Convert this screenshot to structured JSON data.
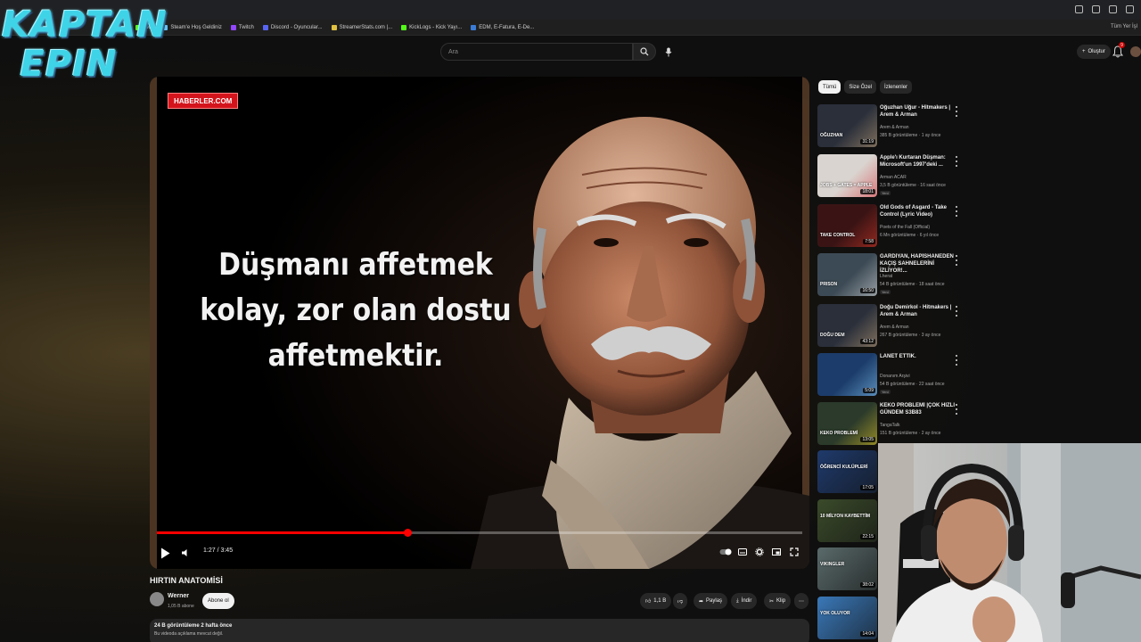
{
  "browser": {
    "bookmarks": [
      {
        "label": "Kick",
        "color": "#53fc18"
      },
      {
        "label": "Steam'e Hoş Geldiniz",
        "color": "#66c0f4"
      },
      {
        "label": "Twitch",
        "color": "#9146ff"
      },
      {
        "label": "Discord - Oyuncular...",
        "color": "#5865f2"
      },
      {
        "label": "StreamerStats.com |...",
        "color": "#e0c040"
      },
      {
        "label": "KickLogs - Kick Yayı...",
        "color": "#53fc18"
      },
      {
        "label": "EDM, E-Fatura, E-De...",
        "color": "#3a7bd5"
      }
    ],
    "bookmarks_right": "Tüm Yer İşl"
  },
  "logo": {
    "line1": "KAPTAN",
    "line2": "EPIN"
  },
  "header": {
    "search_placeholder": "Ara",
    "create_label": "Oluştur",
    "notification_count": "9"
  },
  "player": {
    "source_badge": "HABERLER.COM",
    "quote_lines": [
      "Düşmanı affetmek",
      "kolay, zor olan dostu",
      "affetmektir."
    ],
    "time": "1:27 / 3:45",
    "progress": 0.388
  },
  "video": {
    "title": "HIRTIN ANATOMİSİ",
    "channel": "Werner",
    "subscribers": "1,05 B abone",
    "subscribe_label": "Abone ol",
    "likes": "1,1 B",
    "share_label": "Paylaş",
    "download_label": "İndir",
    "clip_label": "Klip",
    "views_date": "24 B görüntüleme  2 hafta önce",
    "description": "Bu videoda açıklama mevcut değil."
  },
  "sidebar": {
    "chips": [
      "Tümü",
      "Size Özel",
      "İzlenenler"
    ],
    "recommendations": [
      {
        "title": "Oğuzhan Uğur - Hitmakers | Arem & Arman",
        "channel": "Arem & Arman",
        "meta": "385 B görüntüleme · 1 ay önce",
        "duration": "31:19",
        "badge": "",
        "thumb_color": "#2a2f3a",
        "thumb_accent": "#c9a77a",
        "thumb_text": "OĞUZHAN"
      },
      {
        "title": "Apple'ı Kurtaran Düşman: Microsoft'un 1997'deki ...",
        "channel": "Arman ACAR",
        "meta": "3,5 B görüntüleme · 16 saat önce",
        "duration": "18:01",
        "badge": "Yeni",
        "thumb_color": "#d9d4cf",
        "thumb_accent": "#d7262e",
        "thumb_text": "JOBS + GATES = APPLE"
      },
      {
        "title": "Old Gods of Asgard - Take Control (Lyric Video)",
        "channel": "Poets of the Fall (Official)",
        "meta": "6 Mn görüntüleme · 6 yıl önce",
        "duration": "7:58",
        "badge": "",
        "thumb_color": "#3a1414",
        "thumb_accent": "#e23a2a",
        "thumb_text": "TAKE CONTROL"
      },
      {
        "title": "GARDİYAN, HAPİSHANEDEN KAÇIŞ SAHNELERİNİ İZLİYOR!...",
        "channel": "Lherat",
        "meta": "54 B görüntüleme · 18 saat önce",
        "duration": "16:50",
        "badge": "Yeni",
        "thumb_color": "#3c4a55",
        "thumb_accent": "#e8e8e8",
        "thumb_text": "PRISON"
      },
      {
        "title": "Doğu Demirkol - Hitmakers | Arem & Arman",
        "channel": "Arem & Arman",
        "meta": "267 B görüntüleme · 3 ay önce",
        "duration": "43:12",
        "badge": "",
        "thumb_color": "#2a2f3a",
        "thumb_accent": "#c9a77a",
        "thumb_text": "DOĞU DEM"
      },
      {
        "title": "LANET ETTİK.",
        "channel": "Donanım Arşivi",
        "meta": "54 B görüntüleme · 22 saat önce",
        "duration": "5:09",
        "badge": "Yeni",
        "thumb_color": "#1c3d6b",
        "thumb_accent": "#8fd3ff",
        "thumb_text": ""
      },
      {
        "title": "KEKO PROBLEMİ |ÇOK HIZLI GÜNDEM S3B83",
        "channel": "TangaTalk",
        "meta": "151 B görüntüleme · 2 ay önce",
        "duration": "13:05",
        "badge": "",
        "thumb_color": "#2b3a2b",
        "thumb_accent": "#f0d020",
        "thumb_text": "KEKO PROBLEMİ"
      }
    ],
    "extra_thumbs": [
      {
        "duration": "17:05",
        "thumb_color": "#1f3a6b",
        "thumb_text": "ÖĞRENCİ KULÜPLERİ"
      },
      {
        "duration": "22:15",
        "thumb_color": "#3a4a2a",
        "thumb_text": "10 MİLYON KAYBETTİM"
      },
      {
        "duration": "38:02",
        "thumb_color": "#5a6a6a",
        "thumb_text": "VIKINGLER"
      },
      {
        "duration": "14:04",
        "thumb_color": "#3a78b8",
        "thumb_text": "YOK OLUYOR"
      }
    ]
  },
  "colors": {
    "accent": "#ff0000",
    "background": "#0f0f0f",
    "logo": "#3fd3e8"
  }
}
